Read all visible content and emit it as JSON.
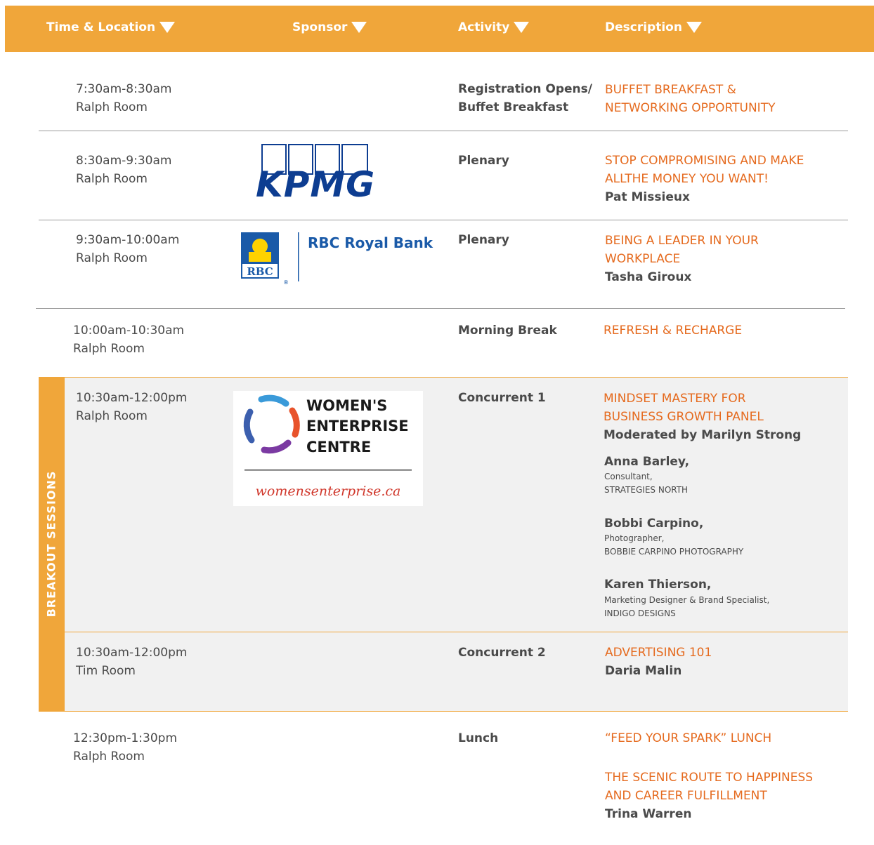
{
  "header": {
    "col_time": "Time & Location",
    "col_sponsor": "Sponsor",
    "col_activity": "Activity",
    "col_description": "Description"
  },
  "breakout_label": "BREAKOUT SESSIONS",
  "sponsors": {
    "kpmg": "KPMG",
    "rbc_crest": "RBC",
    "rbc_name": "RBC Royal Bank",
    "wec_line1": "WOMEN'S",
    "wec_line2": "ENTERPRISE",
    "wec_line3": "CENTRE",
    "wec_url": "womensenterprise.ca"
  },
  "rows": [
    {
      "time": "7:30am-8:30am",
      "room": "Ralph Room",
      "activity_l1": "Registration Opens/",
      "activity_l2": "Buffet Breakfast",
      "desc_l1": "BUFFET BREAKFAST &",
      "desc_l2": "NETWORKING OPPORTUNITY"
    },
    {
      "time": "8:30am-9:30am",
      "room": "Ralph Room",
      "activity": "Plenary",
      "desc_l1": "STOP COMPROMISING AND MAKE",
      "desc_l2": "ALLTHE MONEY YOU WANT!",
      "speaker": "Pat Missieux"
    },
    {
      "time": "9:30am-10:00am",
      "room": "Ralph Room",
      "activity": "Plenary",
      "desc_l1": "BEING A LEADER IN YOUR",
      "desc_l2": "WORKPLACE",
      "speaker": "Tasha Giroux"
    },
    {
      "time": "10:00am-10:30am",
      "room": "Ralph Room",
      "activity": "Morning Break",
      "desc_l1": "REFRESH & RECHARGE"
    },
    {
      "time": "10:30am-12:00pm",
      "room": "Ralph Room",
      "activity": "Concurrent 1",
      "desc_l1": "MINDSET MASTERY FOR",
      "desc_l2": "BUSINESS GROWTH PANEL",
      "moderator": "Moderated by Marilyn Strong",
      "panelists": [
        {
          "name": "Anna Barley,",
          "title": "Consultant,",
          "company": "STRATEGIES NORTH"
        },
        {
          "name": "Bobbi Carpino,",
          "title": "Photographer,",
          "company": "BOBBIE CARPINO PHOTOGRAPHY"
        },
        {
          "name": "Karen Thierson,",
          "title": "Marketing Designer & Brand Specialist,",
          "company": "INDIGO DESIGNS"
        }
      ]
    },
    {
      "time": "10:30am-12:00pm",
      "room": "Tim Room",
      "activity": "Concurrent 2",
      "desc_l1": "ADVERTISING 101",
      "speaker": "Daria Malin"
    },
    {
      "time": "12:30pm-1:30pm",
      "room": "Ralph Room",
      "activity": "Lunch",
      "desc_l1": "“FEED YOUR SPARK” LUNCH",
      "desc2_l1": "THE SCENIC ROUTE TO HAPPINESS",
      "desc2_l2": "AND CAREER FULFILLMENT",
      "speaker": "Trina Warren"
    }
  ],
  "colors": {
    "accent": "#f0a63a",
    "title_orange": "#e56a1e",
    "kpmg_blue": "#0d3d91",
    "rbc_blue": "#1a5aa8",
    "rbc_gold": "#ffd200",
    "wec_red": "#d0362a"
  }
}
